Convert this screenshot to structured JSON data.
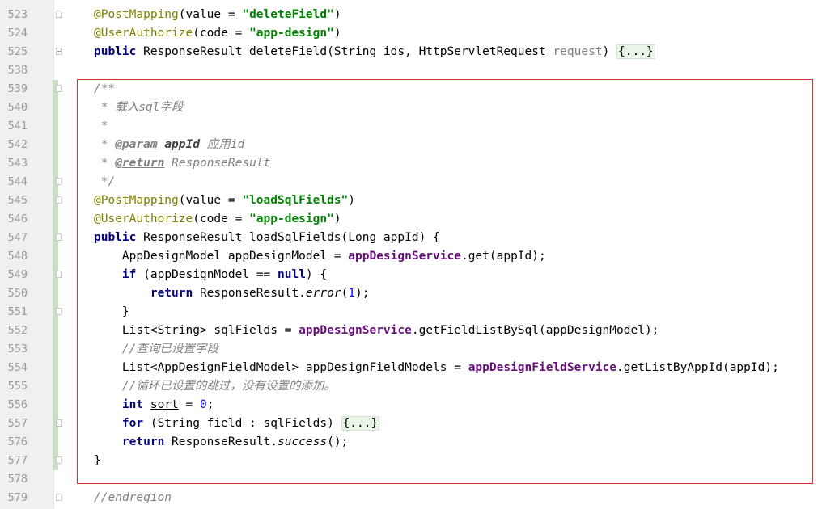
{
  "editor": {
    "lines": [
      {
        "num": "523",
        "segments": [
          [
            "ann",
            "@PostMapping"
          ],
          [
            "",
            "(value = "
          ],
          [
            "str",
            "\"deleteField\""
          ],
          [
            "",
            ")"
          ]
        ]
      },
      {
        "num": "524",
        "segments": [
          [
            "ann",
            "@UserAuthorize"
          ],
          [
            "",
            "(code = "
          ],
          [
            "str",
            "\"app-design\""
          ],
          [
            "",
            ")"
          ]
        ]
      },
      {
        "num": "525",
        "segments": [
          [
            "kw",
            "public "
          ],
          [
            "",
            "ResponseResult deleteField(String ids, HttpServletRequest "
          ],
          [
            "unused",
            "request"
          ],
          [
            "",
            ") "
          ],
          [
            "folded",
            "{...}"
          ]
        ]
      },
      {
        "num": "538",
        "segments": []
      },
      {
        "num": "539",
        "segments": [
          [
            "cmt",
            "/**"
          ]
        ]
      },
      {
        "num": "540",
        "segments": [
          [
            "cmt",
            " * 载入sql字段"
          ]
        ]
      },
      {
        "num": "541",
        "segments": [
          [
            "cmt",
            " *"
          ]
        ]
      },
      {
        "num": "542",
        "segments": [
          [
            "cmt",
            " * "
          ],
          [
            "tag",
            "@param"
          ],
          [
            "cmt",
            " "
          ],
          [
            "param-name",
            "appId"
          ],
          [
            "cmt",
            " 应用id"
          ]
        ]
      },
      {
        "num": "543",
        "segments": [
          [
            "cmt",
            " * "
          ],
          [
            "tag",
            "@return"
          ],
          [
            "cmt",
            " ResponseResult"
          ]
        ]
      },
      {
        "num": "544",
        "segments": [
          [
            "cmt",
            " */"
          ]
        ]
      },
      {
        "num": "545",
        "segments": [
          [
            "ann",
            "@PostMapping"
          ],
          [
            "",
            "(value = "
          ],
          [
            "str",
            "\"loadSqlFields\""
          ],
          [
            "",
            ")"
          ]
        ]
      },
      {
        "num": "546",
        "segments": [
          [
            "ann",
            "@UserAuthorize"
          ],
          [
            "",
            "(code = "
          ],
          [
            "str",
            "\"app-design\""
          ],
          [
            "",
            ")"
          ]
        ]
      },
      {
        "num": "547",
        "segments": [
          [
            "kw",
            "public "
          ],
          [
            "",
            "ResponseResult loadSqlFields(Long appId) {"
          ]
        ]
      },
      {
        "num": "548",
        "segments": [
          [
            "",
            "    AppDesignModel appDesignModel = "
          ],
          [
            "fld",
            "appDesignService"
          ],
          [
            "",
            ".get(appId);"
          ]
        ]
      },
      {
        "num": "549",
        "segments": [
          [
            "",
            "    "
          ],
          [
            "kw",
            "if "
          ],
          [
            "",
            "(appDesignModel == "
          ],
          [
            "kw",
            "null"
          ],
          [
            "",
            ") {"
          ]
        ]
      },
      {
        "num": "550",
        "segments": [
          [
            "",
            "        "
          ],
          [
            "kw",
            "return "
          ],
          [
            "",
            "ResponseResult."
          ],
          [
            "ital",
            "error"
          ],
          [
            "",
            "("
          ],
          [
            "num",
            "1"
          ],
          [
            "",
            ");"
          ]
        ]
      },
      {
        "num": "551",
        "segments": [
          [
            "",
            "    }"
          ]
        ]
      },
      {
        "num": "552",
        "segments": [
          [
            "",
            "    List<String> sqlFields = "
          ],
          [
            "fld",
            "appDesignService"
          ],
          [
            "",
            ".getFieldListBySql(appDesignModel);"
          ]
        ]
      },
      {
        "num": "553",
        "segments": [
          [
            "cmt",
            "    //查询已设置字段"
          ]
        ]
      },
      {
        "num": "554",
        "segments": [
          [
            "",
            "    List<AppDesignFieldModel> appDesignFieldModels = "
          ],
          [
            "fld",
            "appDesignFieldService"
          ],
          [
            "",
            ".getListByAppId(appId);"
          ]
        ]
      },
      {
        "num": "555",
        "segments": [
          [
            "cmt",
            "    //循环已设置的跳过，没有设置的添加。"
          ]
        ]
      },
      {
        "num": "556",
        "segments": [
          [
            "",
            "    "
          ],
          [
            "kw",
            "int "
          ],
          [
            "ul",
            "sort"
          ],
          [
            "",
            " = "
          ],
          [
            "num",
            "0"
          ],
          [
            "",
            ";"
          ]
        ]
      },
      {
        "num": "557",
        "segments": [
          [
            "",
            "    "
          ],
          [
            "kw",
            "for "
          ],
          [
            "",
            "(String field : sqlFields) "
          ],
          [
            "folded",
            "{...}"
          ]
        ]
      },
      {
        "num": "576",
        "segments": [
          [
            "",
            "    "
          ],
          [
            "kw",
            "return "
          ],
          [
            "",
            "ResponseResult."
          ],
          [
            "ital",
            "success"
          ],
          [
            "",
            "();"
          ]
        ]
      },
      {
        "num": "577",
        "segments": [
          [
            "",
            "}"
          ]
        ]
      },
      {
        "num": "578",
        "segments": []
      },
      {
        "num": "579",
        "segments": [
          [
            "cmt",
            "//endregion"
          ]
        ]
      }
    ]
  },
  "colors": {
    "annotation": "#808000",
    "string": "#008000",
    "keyword": "#000080",
    "comment": "#808080",
    "field": "#660e7a",
    "number": "#0000ff",
    "highlight_border": "#d03535"
  }
}
